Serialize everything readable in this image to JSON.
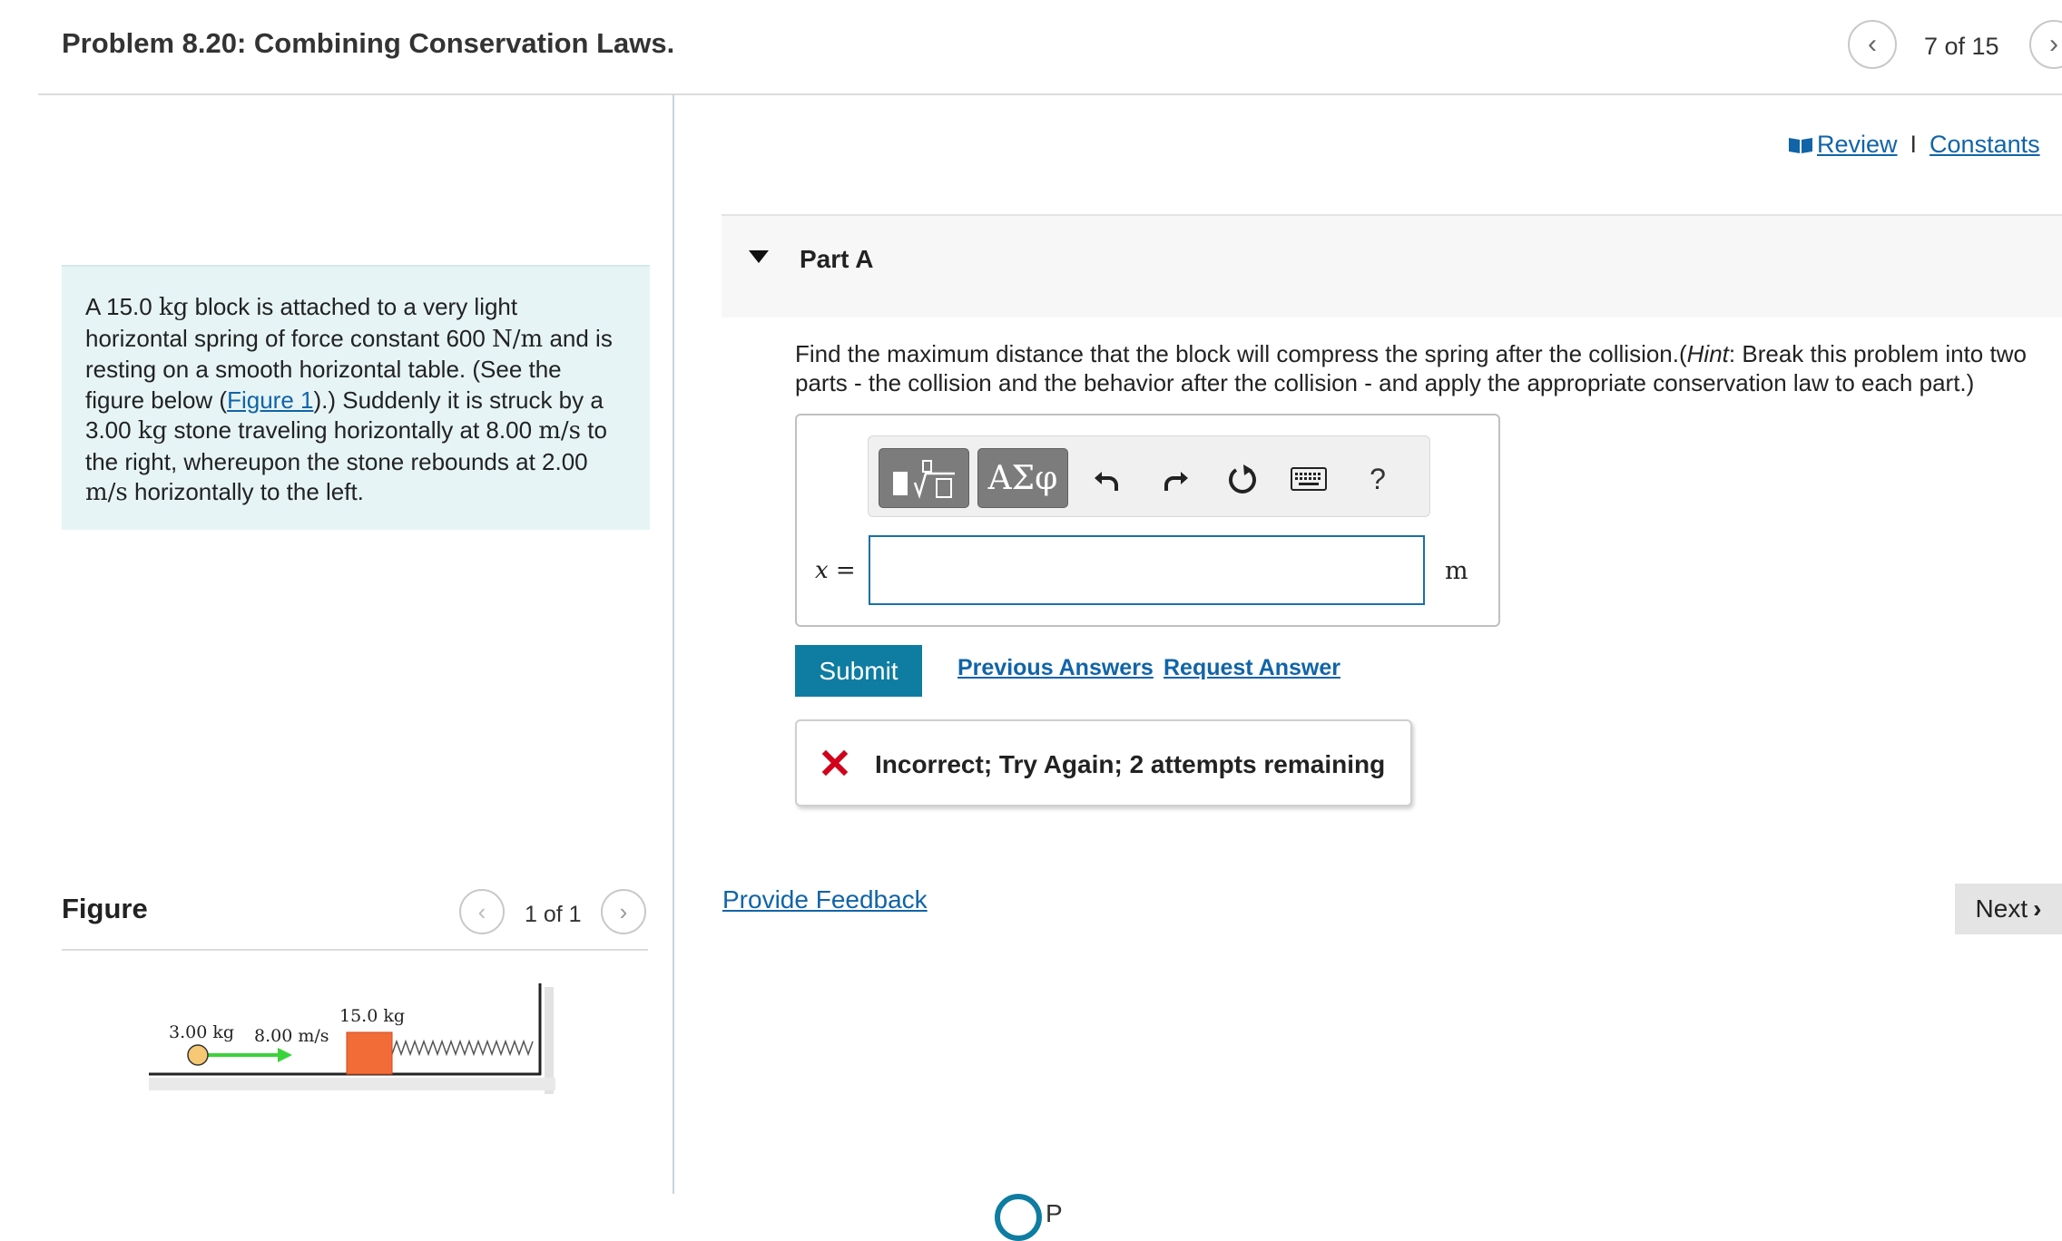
{
  "header": {
    "title": "Problem 8.20: Combining Conservation Laws.",
    "prev_icon": "‹",
    "next_icon": "›",
    "counter": "7 of 15"
  },
  "problem": {
    "parts": [
      "A 15.0 ",
      "kg",
      " block is attached to a very light horizontal spring of force constant 600 ",
      "N/m",
      " and is resting on a smooth horizontal table. (See the figure below (",
      "Figure 1",
      ").) Suddenly it is struck by a 3.00 ",
      "kg",
      " stone traveling horizontally at 8.00 ",
      "m/s",
      " to the right, whereupon the stone rebounds at 2.00 ",
      "m/s",
      " horizontally to the left."
    ]
  },
  "figure": {
    "heading": "Figure",
    "counter": "1 of 1",
    "prev_icon": "‹",
    "next_icon": "›",
    "stone_mass": "3.00 kg",
    "stone_speed": "8.00 m/s",
    "block_mass": "15.0 kg"
  },
  "links": {
    "review": " Review",
    "separator": "I",
    "constants": "Constants"
  },
  "part": {
    "label": "Part A",
    "question_pre": "Find the maximum distance that the block will compress the spring after the collision.(",
    "question_hint": "Hint",
    "question_post": ": Break this problem into two parts - the collision and the behavior after the collision - and apply the appropriate conservation law to each part.)",
    "toolbar": {
      "greek": "ΑΣφ",
      "help": "?"
    },
    "variable": "x =",
    "unit": "m",
    "input_value": "",
    "submit": "Submit",
    "previous_answers": "Previous Answers",
    "request_answer": "Request Answer",
    "feedback": "Incorrect; Try Again; 2 attempts remaining"
  },
  "footer": {
    "provide_feedback": "Provide Feedback",
    "next": "Next",
    "next_icon": "›",
    "logo_text": "P"
  },
  "colors": {
    "accent": "#0f7ca1",
    "link": "#1164a8",
    "problem_bg": "#e6f4f5",
    "error": "#d0021b",
    "arrow": "#3cd23c",
    "block": "#f26c38",
    "stone": "#f7c873"
  }
}
